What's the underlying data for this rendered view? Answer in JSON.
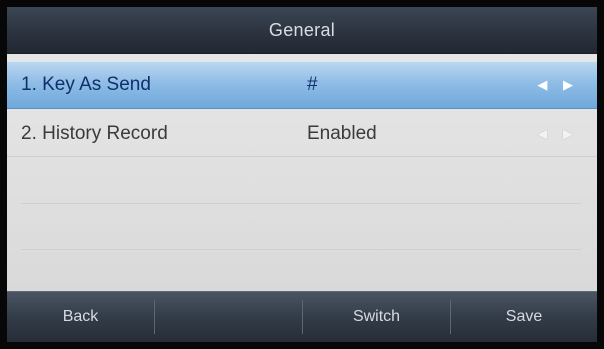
{
  "screen": {
    "title": "General"
  },
  "items": [
    {
      "label": "1. Key As Send",
      "value": "#",
      "arrows": "◀ ▶"
    },
    {
      "label": "2. History Record",
      "value": "Enabled",
      "arrows": "◀ ▶"
    }
  ],
  "softkeys": [
    {
      "label": "Back"
    },
    {
      "label": ""
    },
    {
      "label": "Switch"
    },
    {
      "label": "Save"
    }
  ]
}
